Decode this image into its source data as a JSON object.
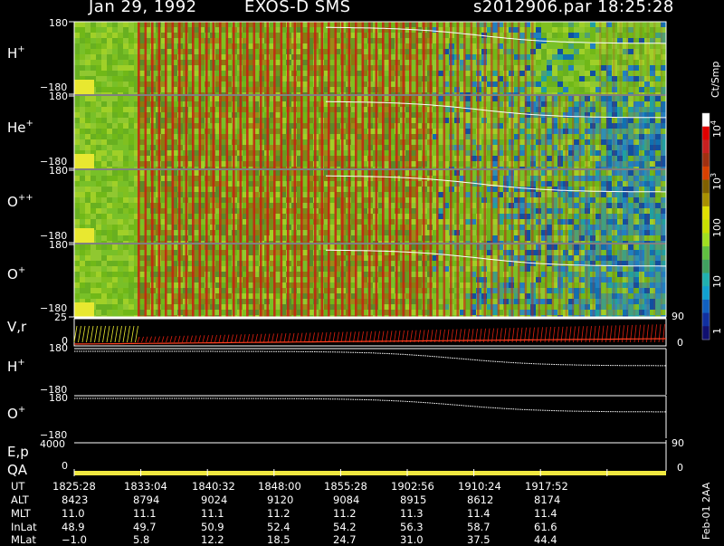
{
  "header": {
    "date": "Jan 29, 1992",
    "instrument": "EXOS-D SMS",
    "file": "s2012906.par",
    "time": "18:25:28"
  },
  "panels": [
    {
      "label": "H",
      "sup": "+",
      "ytop": "180",
      "ybot": "−180"
    },
    {
      "label": "He",
      "sup": "+",
      "ytop": "180",
      "ybot": "−180"
    },
    {
      "label": "O",
      "sup": "++",
      "ytop": "180",
      "ybot": "−180"
    },
    {
      "label": "O",
      "sup": "+",
      "ytop": "180",
      "ybot": "−180"
    },
    {
      "label": "V,r",
      "sup": "",
      "ytop": "25",
      "ybot": "0",
      "rtop": "90",
      "rbot": "0"
    },
    {
      "label": "H",
      "sup": "+",
      "ytop": "180",
      "ybot": "−180"
    },
    {
      "label": "O",
      "sup": "+",
      "ytop": "180",
      "ybot": "−180"
    },
    {
      "label": "E,p",
      "sup": "",
      "ytop": "4000",
      "rtop": "90"
    },
    {
      "label": "QA",
      "sup": "",
      "ybot": "0",
      "rbot": "0"
    }
  ],
  "colorbar": {
    "unit": "Ct/Smp",
    "labels": [
      "10",
      "100",
      "10",
      "10",
      "1"
    ],
    "sups": [
      "4",
      "",
      "3",
      "",
      ""
    ],
    "colors": [
      "#ffffff",
      "#e00000",
      "#c82020",
      "#a03010",
      "#d84000",
      "#806000",
      "#a89000",
      "#e0e000",
      "#c8e000",
      "#a0e020",
      "#60c040",
      "#40a060",
      "#20b0b0",
      "#10a0d0",
      "#1060c0",
      "#1030a0",
      "#101070"
    ]
  },
  "footer": {
    "rows": [
      "UT",
      "ALT",
      "MLT",
      "InLat",
      "MLat"
    ],
    "columns": [
      [
        "1825:28",
        "8423",
        "11.0",
        "48.9",
        "−1.0"
      ],
      [
        "1833:04",
        "8794",
        "11.1",
        "49.7",
        "5.8"
      ],
      [
        "1840:32",
        "9024",
        "11.1",
        "50.9",
        "12.2"
      ],
      [
        "1848:00",
        "9120",
        "11.2",
        "52.4",
        "18.5"
      ],
      [
        "1855:28",
        "9084",
        "11.2",
        "54.2",
        "24.7"
      ],
      [
        "1902:56",
        "8915",
        "11.3",
        "56.3",
        "31.0"
      ],
      [
        "1910:24",
        "8612",
        "11.4",
        "58.7",
        "37.5"
      ],
      [
        "1917:52",
        "8174",
        "11.4",
        "61.6",
        "44.4"
      ]
    ],
    "stamp": "Feb-01 2AA"
  },
  "chart_data": {
    "type": "heatmap",
    "title": "Jan 29, 1992   EXOS-D SMS",
    "x_ticks": [
      "1825:28",
      "1833:04",
      "1840:32",
      "1848:00",
      "1855:28",
      "1902:56",
      "1910:24",
      "1917:52"
    ],
    "series": [
      {
        "name": "H+",
        "ylim": [
          -180,
          180
        ]
      },
      {
        "name": "He+",
        "ylim": [
          -180,
          180
        ]
      },
      {
        "name": "O++",
        "ylim": [
          -180,
          180
        ]
      },
      {
        "name": "O+",
        "ylim": [
          -180,
          180
        ]
      },
      {
        "name": "V,r",
        "ylim": [
          0,
          25
        ],
        "right_ylim": [
          0,
          90
        ]
      },
      {
        "name": "H+",
        "ylim": [
          -180,
          180
        ]
      },
      {
        "name": "O+",
        "ylim": [
          -180,
          180
        ]
      },
      {
        "name": "E,p",
        "ylim": [
          0,
          4000
        ],
        "right_ylim": [
          0,
          90
        ]
      },
      {
        "name": "QA",
        "ylim": [
          0,
          1
        ]
      }
    ],
    "colorscale": {
      "unit": "Ct/Smp",
      "log": true,
      "range": [
        1,
        10000
      ]
    }
  }
}
